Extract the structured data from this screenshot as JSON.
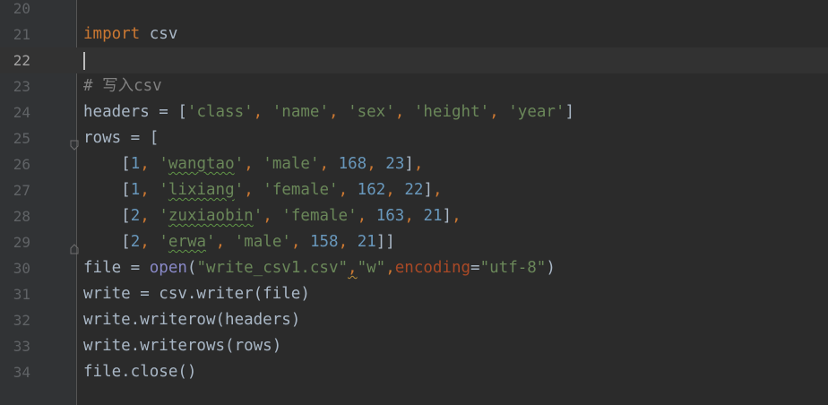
{
  "editor": {
    "current_line": "22",
    "lines": [
      {
        "number": "20",
        "code": ""
      },
      {
        "number": "21",
        "code": "import csv"
      },
      {
        "number": "22",
        "code": ""
      },
      {
        "number": "23",
        "code": "# 写入csv"
      },
      {
        "number": "24",
        "code": "headers = ['class', 'name', 'sex', 'height', 'year']"
      },
      {
        "number": "25",
        "code": "rows = ["
      },
      {
        "number": "26",
        "code": "    [1, 'wangtao', 'male', 168, 23],"
      },
      {
        "number": "27",
        "code": "    [1, 'lixiang', 'female', 162, 22],"
      },
      {
        "number": "28",
        "code": "    [2, 'zuxiaobin', 'female', 163, 21],"
      },
      {
        "number": "29",
        "code": "    [2, 'erwa', 'male', 158, 21]]"
      },
      {
        "number": "30",
        "code": "file = open(\"write_csv1.csv\",\"w\",encoding=\"utf-8\")"
      },
      {
        "number": "31",
        "code": "write = csv.writer(file)"
      },
      {
        "number": "32",
        "code": "write.writerow(headers)"
      },
      {
        "number": "33",
        "code": "write.writerows(rows)"
      },
      {
        "number": "34",
        "code": "file.close()"
      }
    ]
  },
  "colors": {
    "background": "#2b2b2b",
    "keyword": "#cc7832",
    "string": "#6a8759",
    "number": "#6897bb",
    "comment": "#808080",
    "builtin": "#8888c6",
    "default": "#a9b7c6"
  }
}
